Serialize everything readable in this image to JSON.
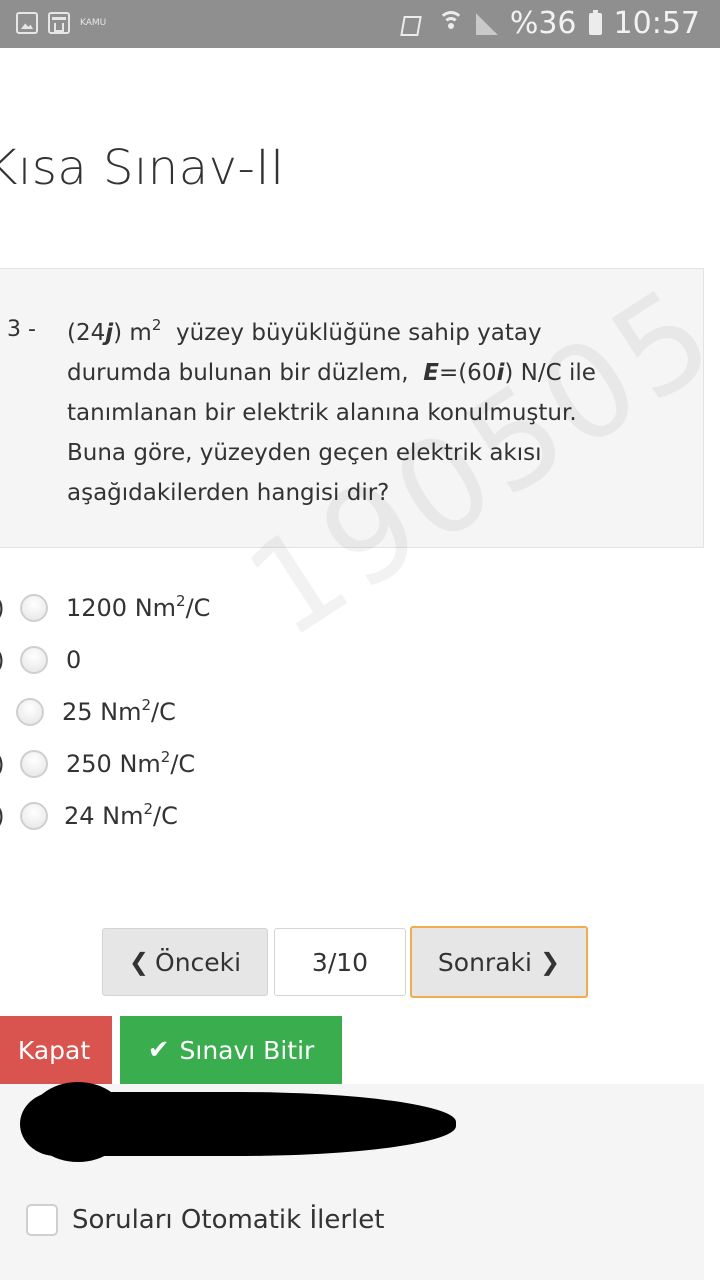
{
  "status_bar": {
    "left_icons": [
      "image-icon",
      "window-icon"
    ],
    "kamu_label": "KAMU",
    "battery": "%36",
    "time": "10:57"
  },
  "page": {
    "title": "Kısa Sınav-II"
  },
  "question": {
    "number": "3 -",
    "line1_pre": "(24",
    "line1_j": "j",
    "line1_mid": ") m",
    "line1_sup": "2",
    "line1_post": "  yüzey büyüklüğüne sahip yatay",
    "line2_pre": "durumda bulunan bir düzlem,  ",
    "line2_E": "E",
    "line2_mid": "=(60",
    "line2_i": "i",
    "line2_post": ") N/C ile",
    "line3": "tanımlanan bir elektrik alanına konulmuştur.",
    "line4": "Buna göre, yüzeyden geçen elektrik akısı",
    "line5": "aşağıdakilerden hangisi dir?"
  },
  "watermark": "190505",
  "options": [
    {
      "paren": ")",
      "value": "1200 Nm",
      "sup": "2",
      "unit": "/C"
    },
    {
      "paren": ")",
      "value": "0",
      "sup": "",
      "unit": ""
    },
    {
      "paren": ")",
      "value": "25 Nm",
      "sup": "2",
      "unit": "/C"
    },
    {
      "paren": ")",
      "value": "250 Nm",
      "sup": "2",
      "unit": "/C"
    },
    {
      "paren": ")",
      "value": "24 Nm",
      "sup": "2",
      "unit": "/C"
    }
  ],
  "pagination": {
    "prev_label": "Önceki",
    "page_indicator": "3/10",
    "next_label": "Sonraki"
  },
  "actions": {
    "close_label": "Kapat",
    "finish_label": "Sınavı Bitir"
  },
  "auto_advance": {
    "label": "Soruları Otomatik İlerlet",
    "checked": false
  },
  "colors": {
    "danger": "#d9534f",
    "success": "#3aad4f",
    "next_border": "#f0ad4e",
    "status_bar": "#8f8f8f"
  }
}
